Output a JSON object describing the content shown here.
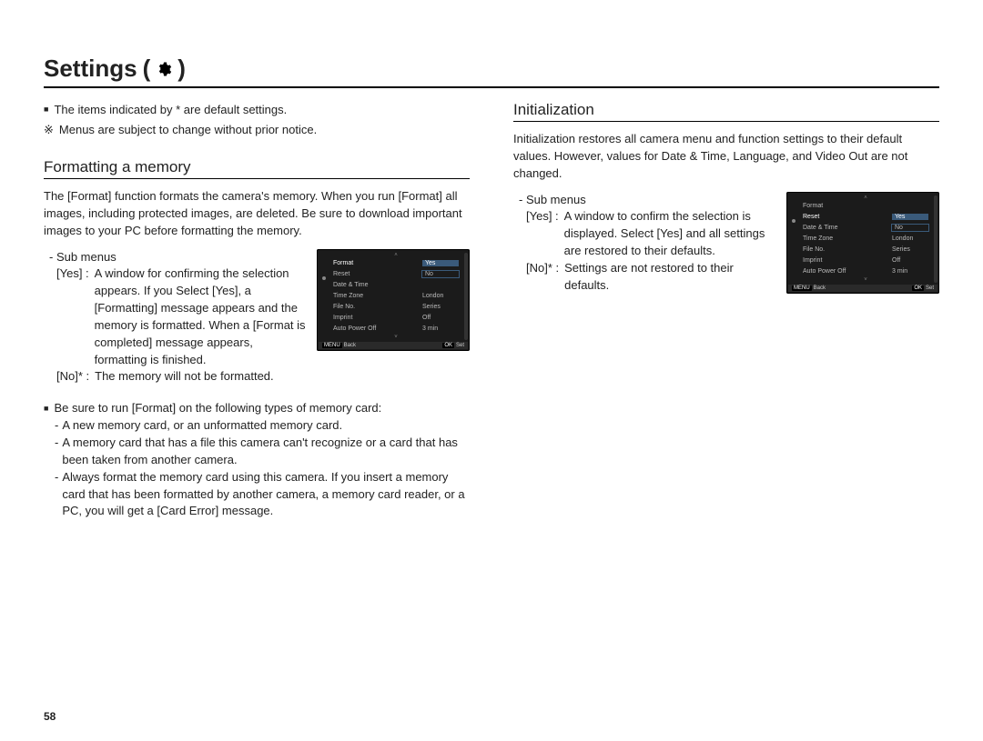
{
  "page_title": "Settings",
  "page_number": "58",
  "notes": {
    "default_note": "The items indicated by * are default settings.",
    "change_note": "Menus are subject to change without prior notice."
  },
  "formatting": {
    "heading": "Formatting a memory",
    "intro": "The [Format] function formats the camera's memory. When you run [Format] all images, including protected images, are deleted. Be sure to download important images to your PC before formatting the memory.",
    "sub_label": "- Sub menus",
    "yes_key": "[Yes] :",
    "yes_txt": "A window for confirming the selection appears. If you Select [Yes], a [Formatting] message appears and the memory is formatted. When a [Format is completed] message appears, formatting is finished.",
    "no_key": "[No]* :",
    "no_txt": "The memory will not be formatted.",
    "run_hd": "Be sure to run [Format] on the following types of memory card:",
    "run1": "A new memory card, or an unformatted memory card.",
    "run2": "A memory card that has a file this camera can't recognize or a card that has been taken from another camera.",
    "run3": "Always format the memory card using this camera. If you insert a memory card that has been formatted by another camera, a memory card reader, or a PC, you will get a [Card Error] message."
  },
  "initialization": {
    "heading": "Initialization",
    "intro": "Initialization restores all camera menu and function settings to their default values. However, values for Date & Time, Language, and Video Out are not changed.",
    "sub_label": "- Sub menus",
    "yes_key": "[Yes] :",
    "yes_txt": "A window to confirm the selection is displayed. Select [Yes] and all settings are restored to their defaults.",
    "no_key": "[No]* :",
    "no_txt": "Settings are not restored to their defaults."
  },
  "mini_menu": {
    "items": [
      {
        "l": "Format",
        "r": ""
      },
      {
        "l": "Reset",
        "r": ""
      },
      {
        "l": "Date & Time",
        "r": ""
      },
      {
        "l": "Time Zone",
        "r": "London"
      },
      {
        "l": "File No.",
        "r": "Series"
      },
      {
        "l": "Imprint",
        "r": "Off"
      },
      {
        "l": "Auto Power Off",
        "r": "3 min"
      }
    ],
    "popup_yes": "Yes",
    "popup_no": "No",
    "footer_back_btn": "MENU",
    "footer_back": "Back",
    "footer_set_btn": "OK",
    "footer_set": "Set"
  }
}
